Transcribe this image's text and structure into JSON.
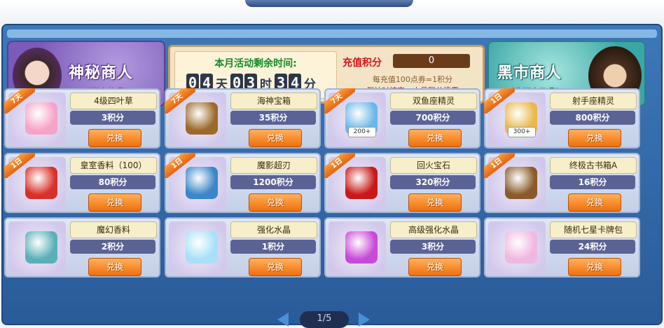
{
  "mystic_merchant": {
    "title": "神秘商人",
    "subtitle": "（绑定物品）"
  },
  "black_merchant": {
    "title": "黑市商人",
    "subtitle": "（非绑定物品）"
  },
  "timer": {
    "label": "本月活动剩余时间:",
    "days": [
      "0",
      "4"
    ],
    "day_unit": "天",
    "hours": [
      "0",
      "3"
    ],
    "hour_unit": "时",
    "minutes": [
      "3",
      "4"
    ],
    "minute_unit": "分"
  },
  "points": {
    "label": "充值积分",
    "value": "0",
    "note1": "每充值100点券=1积分",
    "note2": "倒计时结束，本月积分清零"
  },
  "items": [
    {
      "name": "4级四叶草",
      "cost": "3积分",
      "btn": "兑换",
      "tag": "7天",
      "icon": "four-leaf-clover-icon",
      "color": "#f6a3c6"
    },
    {
      "name": "海神宝箱",
      "cost": "35积分",
      "btn": "兑换",
      "tag": "7天",
      "icon": "treasure-chest-icon",
      "color": "#9b6a2a"
    },
    {
      "name": "双鱼座精灵",
      "cost": "700积分",
      "btn": "兑换",
      "tag": "7天",
      "icon": "pisces-spirit-card-icon",
      "color": "#6ab8e8",
      "price": "200+"
    },
    {
      "name": "射手座精灵",
      "cost": "800积分",
      "btn": "兑换",
      "tag": "1日",
      "icon": "sagittarius-spirit-card-icon",
      "color": "#e8b84a",
      "price": "300+"
    },
    {
      "name": "皇室香料（100）",
      "cost": "80积分",
      "btn": "兑换",
      "tag": "1日",
      "icon": "gift-box-icon",
      "color": "#d8302a"
    },
    {
      "name": "魔影超刃",
      "cost": "1200积分",
      "btn": "兑换",
      "tag": "1日",
      "icon": "shadow-blade-icon",
      "color": "#3a86c8"
    },
    {
      "name": "回火宝石",
      "cost": "320积分",
      "btn": "兑换",
      "tag": "1日",
      "icon": "red-gem-icon",
      "color": "#c81818"
    },
    {
      "name": "终极古书箱A",
      "cost": "16积分",
      "btn": "兑换",
      "tag": "1日",
      "icon": "ancient-book-icon",
      "color": "#8a5a2a"
    },
    {
      "name": "魔幻香料",
      "cost": "2积分",
      "btn": "兑换",
      "tag": "",
      "icon": "magic-spice-icon",
      "color": "#5ab0b8"
    },
    {
      "name": "强化水晶",
      "cost": "1积分",
      "btn": "兑换",
      "tag": "",
      "icon": "crystal-icon",
      "color": "#a8e0f8"
    },
    {
      "name": "高级强化水晶",
      "cost": "3积分",
      "btn": "兑换",
      "tag": "",
      "icon": "purple-crystal-icon",
      "color": "#c84ad8"
    },
    {
      "name": "随机七星卡牌包",
      "cost": "24积分",
      "btn": "兑换",
      "tag": "",
      "icon": "card-pack-icon",
      "color": "#f0b8e0"
    }
  ],
  "pager": {
    "text": "1/5"
  }
}
